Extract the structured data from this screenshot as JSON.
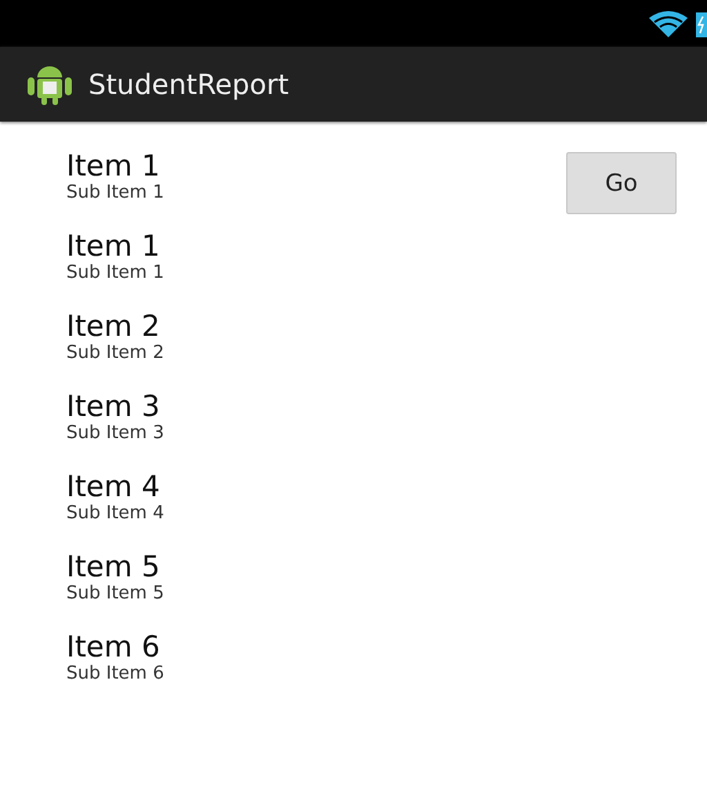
{
  "app_bar": {
    "title": "StudentReport"
  },
  "go_button": {
    "label": "Go"
  },
  "list": [
    {
      "title": "Item 1",
      "subtitle": "Sub Item 1"
    },
    {
      "title": "Item 1",
      "subtitle": "Sub Item 1"
    },
    {
      "title": "Item 2",
      "subtitle": "Sub Item 2"
    },
    {
      "title": "Item 3",
      "subtitle": "Sub Item 3"
    },
    {
      "title": "Item 4",
      "subtitle": "Sub Item 4"
    },
    {
      "title": "Item 5",
      "subtitle": "Sub Item 5"
    },
    {
      "title": "Item 6",
      "subtitle": "Sub Item 6"
    }
  ]
}
